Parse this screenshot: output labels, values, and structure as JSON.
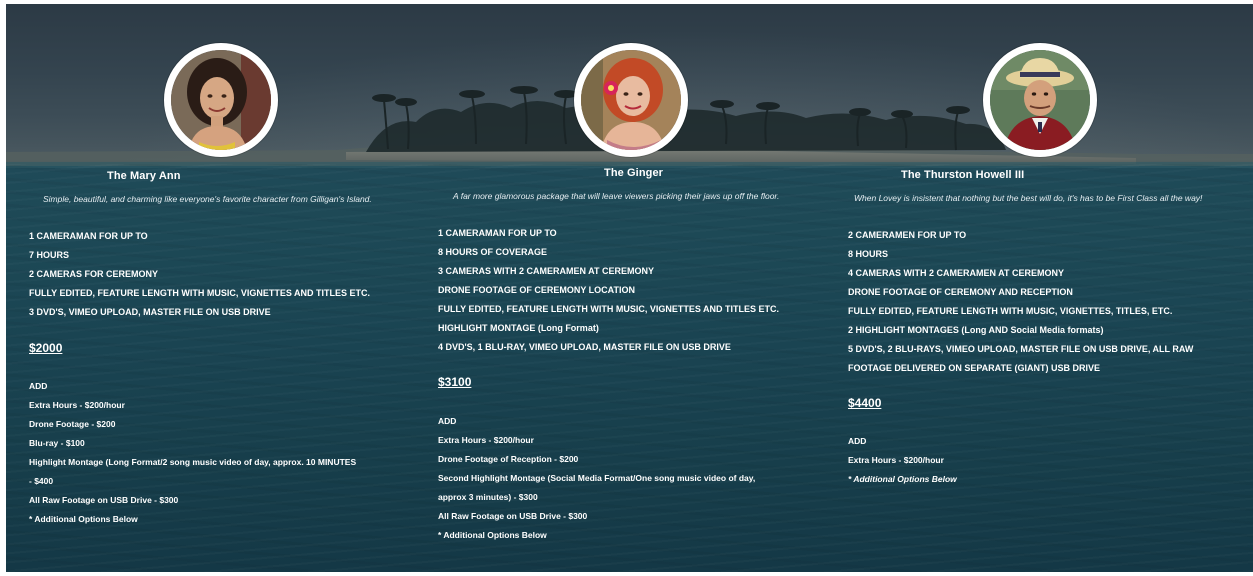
{
  "packages": [
    {
      "title": "The Mary Ann",
      "description": "Simple, beautiful, and charming like everyone's favorite character from Gilligan's Island.",
      "features": [
        "1 CAMERAMAN FOR UP TO",
        "7 HOURS",
        "2 CAMERAS FOR CEREMONY",
        "FULLY EDITED, FEATURE LENGTH WITH MUSIC, VIGNETTES  AND TITLES ETC.",
        "3 DVD'S, VIMEO UPLOAD, MASTER FILE ON USB DRIVE"
      ],
      "price": "$2000",
      "add_label": "ADD",
      "addons": [
        "Extra Hours - $200/hour",
        "Drone Footage - $200",
        "Blu-ray - $100",
        "Highlight Montage (Long Format/2 song music video of day, approx. 10 MINUTES",
        "- $400",
        "All Raw Footage on USB Drive - $300",
        "* Additional Options Below"
      ]
    },
    {
      "title": "The Ginger",
      "description": "A far more glamorous package that will leave viewers picking their jaws up off the floor.",
      "features": [
        "1 CAMERAMAN FOR UP TO",
        "8 HOURS OF COVERAGE",
        "3 CAMERAS WITH 2 CAMERAMEN AT CEREMONY",
        "DRONE FOOTAGE OF CEREMONY LOCATION",
        "FULLY EDITED, FEATURE LENGTH WITH MUSIC, VIGNETTES AND TITLES ETC.",
        "HIGHLIGHT MONTAGE (Long Format)",
        "4 DVD'S, 1 BLU-RAY, VIMEO UPLOAD, MASTER FILE ON USB DRIVE"
      ],
      "price": "$3100",
      "add_label": "ADD",
      "addons": [
        "Extra Hours - $200/hour",
        "Drone Footage of Reception - $200",
        "Second Highlight Montage (Social Media Format/One song music video of day,",
        "approx 3 minutes) - $300",
        "All Raw Footage on USB Drive - $300",
        "* Additional Options Below"
      ]
    },
    {
      "title": "The Thurston Howell III",
      "description": "When Lovey is insistent that nothing but the best will do, it's has to be First Class all the way!",
      "features": [
        "2 CAMERAMEN FOR UP TO",
        "8 HOURS",
        "4 CAMERAS WITH 2 CAMERAMEN AT CEREMONY",
        "DRONE FOOTAGE OF CEREMONY AND RECEPTION",
        "FULLY EDITED, FEATURE LENGTH WITH MUSIC, VIGNETTES, TITLES, ETC.",
        "2 HIGHLIGHT MONTAGES (Long AND Social Media formats)",
        "5 DVD'S, 2 BLU-RAYS, VIMEO UPLOAD, MASTER FILE ON USB DRIVE, ALL RAW",
        "FOOTAGE DELIVERED ON SEPARATE (GIANT) USB DRIVE"
      ],
      "price": "$4400",
      "add_label": "ADD",
      "addons": [
        "Extra Hours - $200/hour",
        "* Additional Options Below"
      ]
    }
  ],
  "colors": {
    "text": "#ffffff",
    "water": "#1d4956",
    "sky": "#34444f",
    "avatar_border": "#ffffff"
  }
}
